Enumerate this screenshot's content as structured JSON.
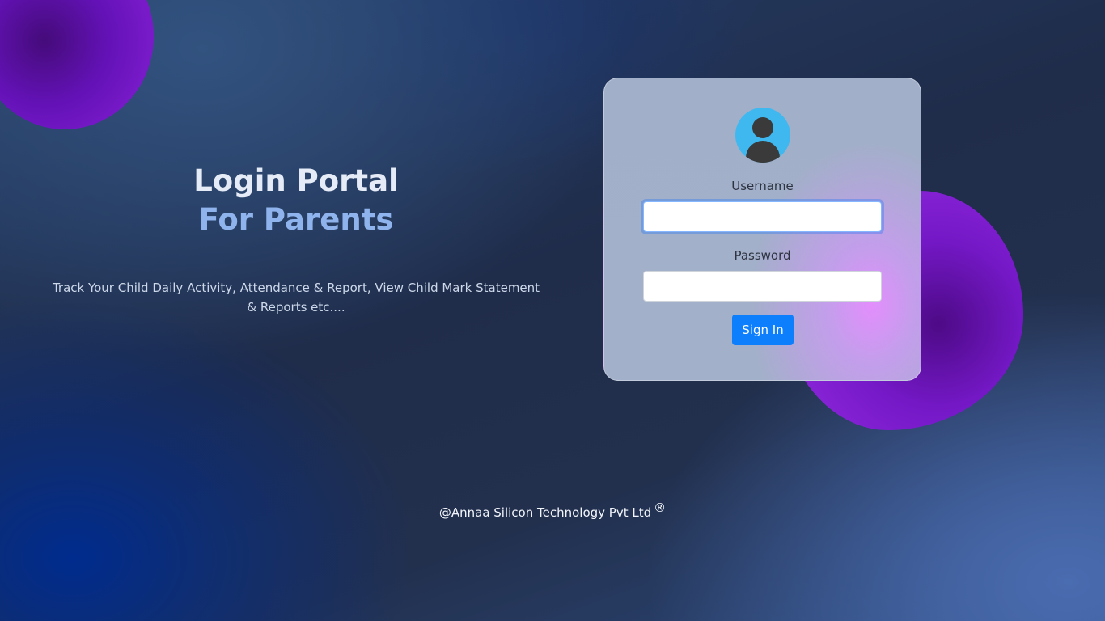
{
  "hero": {
    "title": "Login Portal",
    "subtitle": "For Parents",
    "description": "Track Your Child Daily Activity, Attendance & Report, View Child Mark Statement & Reports etc...."
  },
  "login_form": {
    "avatar_icon": "user-avatar-icon",
    "username_label": "Username",
    "username_value": "",
    "password_label": "Password",
    "password_value": "",
    "signin_label": "Sign In"
  },
  "footer": {
    "copyright": "@Annaa Silicon Technology Pvt Ltd",
    "registered_mark": "®"
  },
  "colors": {
    "accent_button": "#0d7efc",
    "title_text": "#e6ecf7",
    "subtitle_text": "#8fb3ec",
    "avatar_bg": "#3fb8f0",
    "blob_purple": "#8c22d8"
  }
}
